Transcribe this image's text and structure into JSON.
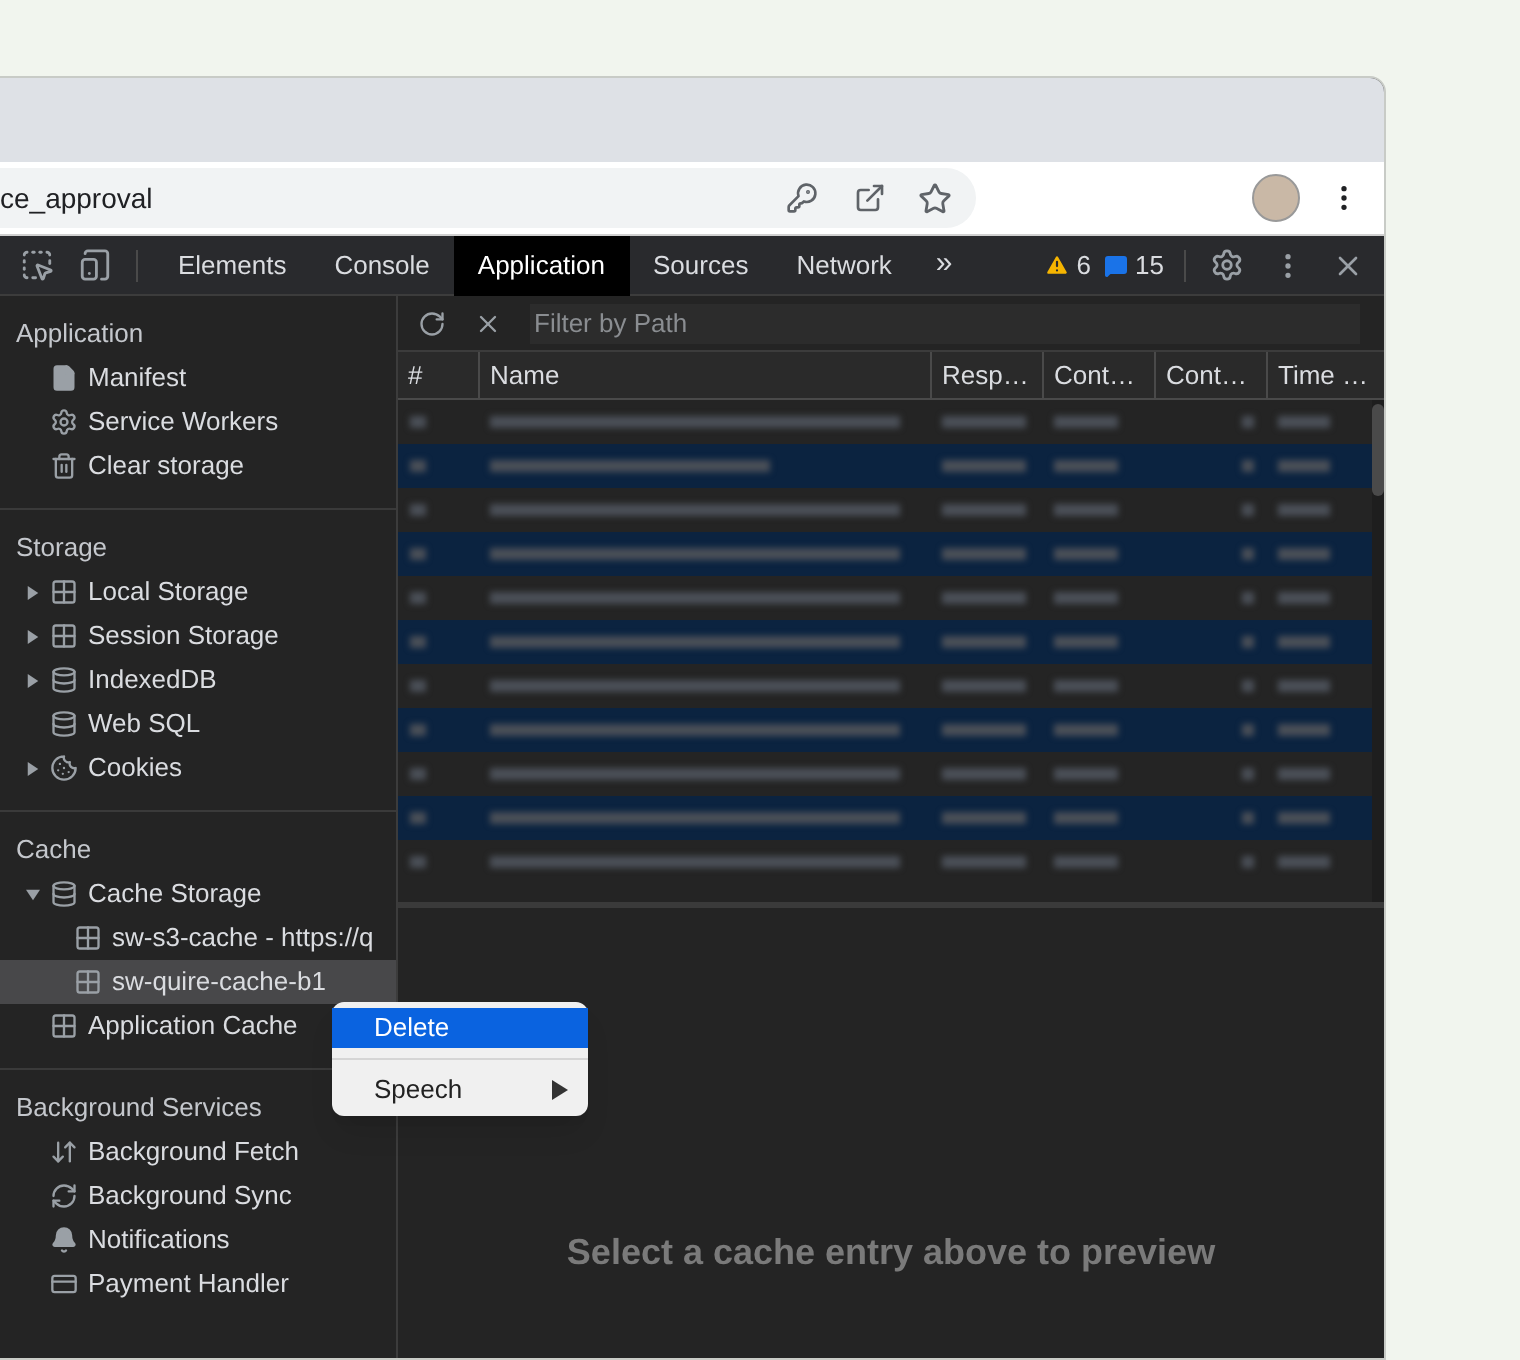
{
  "address_bar": {
    "url": "ce_approval"
  },
  "devtools": {
    "tabs": [
      {
        "label": "Elements",
        "selected": false
      },
      {
        "label": "Console",
        "selected": false
      },
      {
        "label": "Application",
        "selected": true
      },
      {
        "label": "Sources",
        "selected": false
      },
      {
        "label": "Network",
        "selected": false
      }
    ],
    "more_tabs": "»",
    "warnings": "6",
    "messages": "15"
  },
  "sidebar": {
    "sections": [
      {
        "title": "Application",
        "items": [
          {
            "label": "Manifest",
            "kind": "file",
            "expandable": false,
            "selected": false
          },
          {
            "label": "Service Workers",
            "kind": "gear",
            "expandable": false,
            "selected": false
          },
          {
            "label": "Clear storage",
            "kind": "trash",
            "expandable": false,
            "selected": false
          }
        ]
      },
      {
        "title": "Storage",
        "items": [
          {
            "label": "Local Storage",
            "kind": "grid",
            "expandable": true,
            "expanded": false,
            "selected": false
          },
          {
            "label": "Session Storage",
            "kind": "grid",
            "expandable": true,
            "expanded": false,
            "selected": false
          },
          {
            "label": "IndexedDB",
            "kind": "database",
            "expandable": true,
            "expanded": false,
            "selected": false
          },
          {
            "label": "Web SQL",
            "kind": "database",
            "expandable": false,
            "selected": false
          },
          {
            "label": "Cookies",
            "kind": "cookie",
            "expandable": true,
            "expanded": false,
            "selected": false
          }
        ]
      },
      {
        "title": "Cache",
        "items": [
          {
            "label": "Cache Storage",
            "kind": "database",
            "expandable": true,
            "expanded": true,
            "selected": false,
            "children": [
              {
                "label": "sw-s3-cache - https://q",
                "kind": "grid",
                "expandable": false,
                "selected": false
              },
              {
                "label": "sw-quire-cache-b1",
                "kind": "grid",
                "expandable": false,
                "selected": true
              }
            ]
          },
          {
            "label": "Application Cache",
            "kind": "grid",
            "expandable": false,
            "selected": false
          }
        ]
      },
      {
        "title": "Background Services",
        "items": [
          {
            "label": "Background Fetch",
            "kind": "updown",
            "expandable": false,
            "selected": false
          },
          {
            "label": "Background Sync",
            "kind": "sync",
            "expandable": false,
            "selected": false
          },
          {
            "label": "Notifications",
            "kind": "bell",
            "expandable": false,
            "selected": false
          },
          {
            "label": "Payment Handler",
            "kind": "card",
            "expandable": false,
            "selected": false
          }
        ]
      }
    ]
  },
  "filter": {
    "placeholder": "Filter by Path"
  },
  "table": {
    "columns": [
      "#",
      "Name",
      "Resp…",
      "Cont…",
      "Cont…",
      "Time …"
    ],
    "rows": [
      {
        "highlighted": false
      },
      {
        "highlighted": true
      },
      {
        "highlighted": false
      },
      {
        "highlighted": true
      },
      {
        "highlighted": false
      },
      {
        "highlighted": true
      },
      {
        "highlighted": false
      },
      {
        "highlighted": true
      },
      {
        "highlighted": false
      },
      {
        "highlighted": true
      },
      {
        "highlighted": false
      }
    ]
  },
  "preview": {
    "message": "Select a cache entry above to preview"
  },
  "context_menu": {
    "items": [
      {
        "label": "Delete",
        "selected": true,
        "submenu": false
      },
      {
        "label": "Speech",
        "selected": false,
        "submenu": true
      }
    ]
  }
}
